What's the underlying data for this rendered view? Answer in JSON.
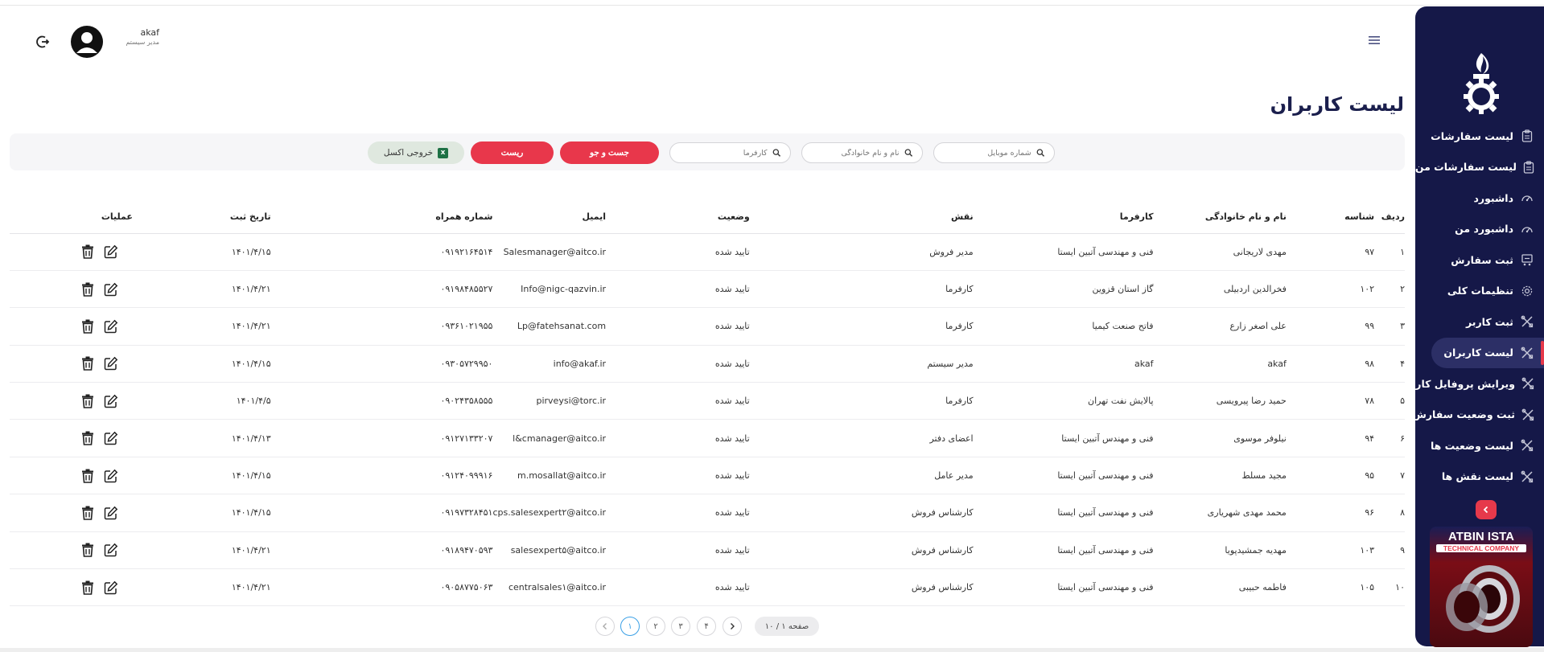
{
  "header": {
    "user_name": "akaf",
    "user_role": "مدیر سیستم"
  },
  "page": {
    "title": "لیست کاربران"
  },
  "filters": {
    "mobile_placeholder": "شماره موبایل",
    "name_placeholder": "نام و نام خانوادگی",
    "employer_placeholder": "کارفرما",
    "search_label": "جست و جو",
    "reset_label": "ریست",
    "excel_label": "خروجی اکسل"
  },
  "sidebar": {
    "items": [
      {
        "label": "لیست سفارشات",
        "icon": "clipboard-icon"
      },
      {
        "label": "لیست سفارشات من",
        "icon": "clipboard-icon"
      },
      {
        "label": "داشبورد",
        "icon": "gauge-icon"
      },
      {
        "label": "داشبورد من",
        "icon": "gauge-icon"
      },
      {
        "label": "ثبت سفارش",
        "icon": "cart-icon"
      },
      {
        "label": "تنظیمات کلی",
        "icon": "gear-icon"
      },
      {
        "label": "ثبت کاربر",
        "icon": "tools-icon"
      },
      {
        "label": "لیست کاربران",
        "icon": "tools-icon",
        "active": true
      },
      {
        "label": "ویرایش پروفایل کاربری",
        "icon": "tools-icon"
      },
      {
        "label": "ثبت وضعیت سفارش",
        "icon": "tools-icon"
      },
      {
        "label": "لیست وضعیت ها",
        "icon": "tools-icon"
      },
      {
        "label": "لیست نقش ها",
        "icon": "tools-icon"
      }
    ],
    "banner_title": "ATBIN ISTA",
    "banner_subtitle": "TECHNICAL COMPANY"
  },
  "table": {
    "columns": [
      "ردیف",
      "شناسه",
      "نام و نام خانوادگی",
      "کارفرما",
      "نقش",
      "وضعیت",
      "ایمیل",
      "شماره همراه",
      "تاریخ ثبت",
      "عملیات"
    ],
    "rows": [
      [
        "۱",
        "۹۷",
        "مهدی لاریجانی",
        "فنی و مهندسی آتبین ایستا",
        "مدیر فروش",
        "تایید شده",
        "Salesmanager@aitco.ir",
        "۰۹۱۹۲۱۶۴۵۱۴",
        "۱۴۰۱/۴/۱۵"
      ],
      [
        "۲",
        "۱۰۲",
        "فخرالدین اردبیلی",
        "گاز استان قزوین",
        "کارفرما",
        "تایید شده",
        "Info@nigc-qazvin.ir",
        "۰۹۱۹۸۴۸۵۵۲۷",
        "۱۴۰۱/۴/۲۱"
      ],
      [
        "۳",
        "۹۹",
        "علی اصغر زارع",
        "فاتح صنعت کیمیا",
        "کارفرما",
        "تایید شده",
        "Lp@fatehsanat.com",
        "۰۹۳۶۱۰۲۱۹۵۵",
        "۱۴۰۱/۴/۲۱"
      ],
      [
        "۴",
        "۹۸",
        "akaf",
        "akaf",
        "مدیر سیستم",
        "تایید شده",
        "info@akaf.ir",
        "۰۹۳۰۵۷۲۹۹۵۰",
        "۱۴۰۱/۴/۱۵"
      ],
      [
        "۵",
        "۷۸",
        "حمید رضا پیرویسی",
        "پالایش نفت تهران",
        "کارفرما",
        "تایید شده",
        "pirveysi@torc.ir",
        "۰۹۰۲۴۳۵۸۵۵۵",
        "۱۴۰۱/۴/۵"
      ],
      [
        "۶",
        "۹۴",
        "نیلوفر موسوی",
        "فنی و مهندس آتبین ایستا",
        "اعضای دفتر",
        "تایید شده",
        "l&cmanager@aitco.ir",
        "۰۹۱۲۷۱۳۳۲۰۷",
        "۱۴۰۱/۴/۱۳"
      ],
      [
        "۷",
        "۹۵",
        "مجید مسلط",
        "فنی و مهندسی آتبین ایستا",
        "مدیر عامل",
        "تایید شده",
        "m.mosallat@aitco.ir",
        "۰۹۱۲۴۰۹۹۹۱۶",
        "۱۴۰۱/۴/۱۵"
      ],
      [
        "۸",
        "۹۶",
        "محمد مهدی شهریاری",
        "فنی و مهندسی آتبین ایستا",
        "کارشناس فروش",
        "تایید شده",
        "cps.salesexpert۲@aitco.ir",
        "۰۹۱۹۷۳۲۸۴۵۱",
        "۱۴۰۱/۴/۱۵"
      ],
      [
        "۹",
        "۱۰۳",
        "مهدیه جمشیدپویا",
        "فنی و مهندسی آتبین ایستا",
        "کارشناس فروش",
        "تایید شده",
        "salesexpert۵@aitco.ir",
        "۰۹۱۸۹۴۷۰۵۹۳",
        "۱۴۰۱/۴/۲۱"
      ],
      [
        "۱۰",
        "۱۰۵",
        "فاطمه حبیبی",
        "فنی و مهندسی آتبین ایستا",
        "کارشناس فروش",
        "تایید شده",
        "centralsales۱@aitco.ir",
        "۰۹۰۵۸۷۷۵۰۶۳",
        "۱۴۰۱/۴/۲۱"
      ]
    ]
  },
  "pagination": {
    "pages": [
      "۱",
      "۲",
      "۳",
      "۴"
    ],
    "current": "۱",
    "info": "صفحه ۱ / ۱۰"
  },
  "colors": {
    "sidebar_bg": "#151848",
    "accent_red": "#e8374b",
    "active_page": "#3aa0e6"
  }
}
